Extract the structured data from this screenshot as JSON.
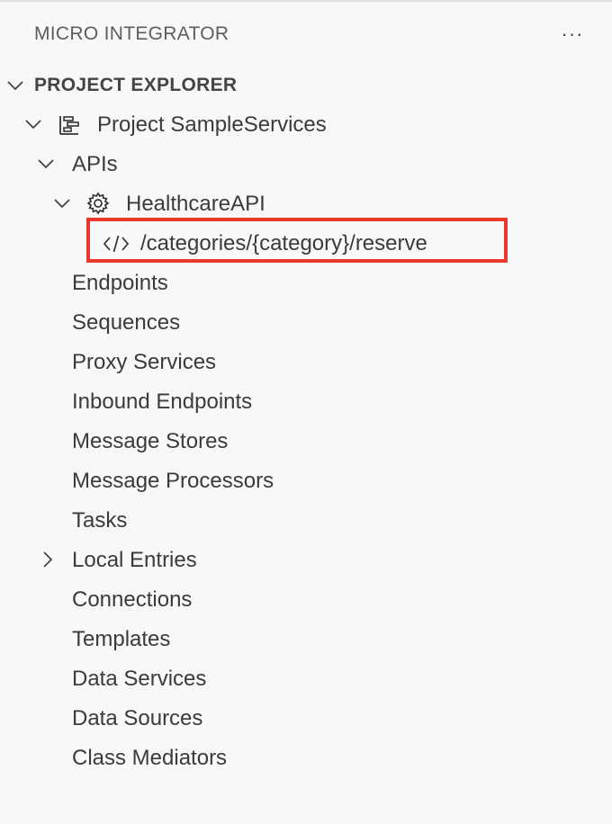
{
  "panel": {
    "title": "MICRO INTEGRATOR",
    "more_actions": "···"
  },
  "section": {
    "title": "PROJECT EXPLORER",
    "expanded": true
  },
  "tree": {
    "project": {
      "label": "Project SampleServices",
      "icon": "project-icon",
      "expanded": true
    },
    "apis": {
      "label": "APIs",
      "expanded": true
    },
    "api": {
      "label": "HealthcareAPI",
      "icon": "gear-icon",
      "expanded": true
    },
    "resource": {
      "label": "/categories/{category}/reserve",
      "icon": "code-icon",
      "highlighted": true
    },
    "items": [
      {
        "label": "Endpoints"
      },
      {
        "label": "Sequences"
      },
      {
        "label": "Proxy Services"
      },
      {
        "label": "Inbound Endpoints"
      },
      {
        "label": "Message Stores"
      },
      {
        "label": "Message Processors"
      },
      {
        "label": "Tasks"
      },
      {
        "label": "Local Entries",
        "collapsible": true,
        "expanded": false
      },
      {
        "label": "Connections"
      },
      {
        "label": "Templates"
      },
      {
        "label": "Data Services"
      },
      {
        "label": "Data Sources"
      },
      {
        "label": "Class Mediators"
      }
    ]
  },
  "colors": {
    "highlight_border": "#e8392b",
    "background": "#f8f8f8",
    "text": "#3b3b3b"
  }
}
